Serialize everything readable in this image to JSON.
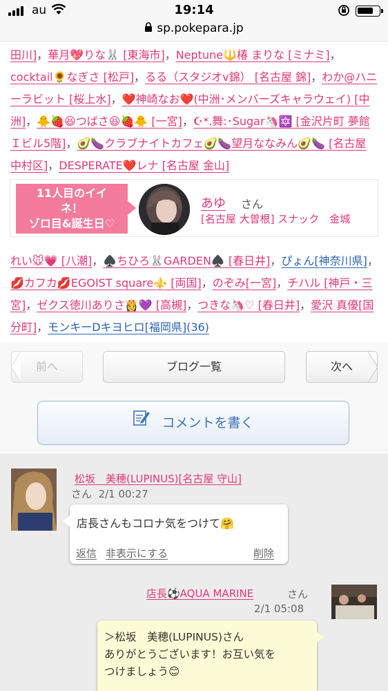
{
  "status_bar": {
    "carrier": "au",
    "time": "19:14",
    "battery_level": 0.75
  },
  "browser": {
    "url": "sp.pokepara.jp"
  },
  "link_list_top": [
    {
      "text": "田川]",
      "sep": "，"
    },
    {
      "text": "華月💖りな🐰 [東海市]",
      "sep": "，"
    },
    {
      "text": "Neptune🔱椿 まりな [ミナミ]",
      "sep": "，"
    },
    {
      "text": "cocktail🌻なぎさ [松戸]",
      "sep": "，"
    },
    {
      "text": "るる（スタジオv錦） [名古屋 錦]",
      "sep": "，"
    },
    {
      "text": "わか@ハニーラビット [桜上水]",
      "sep": "，"
    },
    {
      "text": "❤️神崎なお❤️(中洲･メンバーズキャラウェイ) [中洲]",
      "sep": "，"
    },
    {
      "text": "🐥🍓😆つばさ😆🍓🐥 [一宮]",
      "sep": "，"
    },
    {
      "text": "☪︎*.舞:･Sugar🦄🔯 [金沢片町 夢館Ｉビル5階]",
      "sep": "，"
    },
    {
      "text": "🥑🍆クラブナイトカフェ🥑🍆望月ななみん🥑🍆 [名古屋 中村区]",
      "sep": "，"
    },
    {
      "text": "DESPERATE❤️レナ [名古屋 金山]",
      "sep": ""
    }
  ],
  "iine_box": {
    "badge_line1": "11人目のイイ",
    "badge_line2": "ネ！",
    "badge_line3": "ゾロ目&誕生日♡",
    "name": "あゆ",
    "suffix": "さん",
    "shop": "[名古屋 大曽根] スナック　金城"
  },
  "link_list_bottom": [
    {
      "text": "れい🐭💗 [八潮]",
      "sep": "，",
      "color": "red"
    },
    {
      "text": "♠️ちひろ🐰GARDEN♠️ [春日井]",
      "sep": "，",
      "color": "red"
    },
    {
      "text": "ぴょん[神奈川県]",
      "sep": "，",
      "color": "blue"
    },
    {
      "text": "💋カフカ💋EGOIST square⚜️ [両国]",
      "sep": "，",
      "color": "red"
    },
    {
      "text": "のぞみ[一宮]",
      "sep": "，",
      "color": "red"
    },
    {
      "text": "チハル [神戸・三宮]",
      "sep": "，",
      "color": "red"
    },
    {
      "text": "ゼクス徳川ありさ👸💜 [高槻]",
      "sep": "，",
      "color": "red"
    },
    {
      "text": "つきな🦄♡ [春日井]",
      "sep": "，",
      "color": "red"
    },
    {
      "text": "愛沢 真優[国分町]",
      "sep": "，",
      "color": "red"
    },
    {
      "text": "モンキーDキヨヒロ[福岡県](36)",
      "sep": "",
      "color": "blue"
    }
  ],
  "nav": {
    "prev": "前へ",
    "list": "ブログ一覧",
    "next": "次へ",
    "comment": "コメントを書く"
  },
  "comments": [
    {
      "name": "松坂　美穂(LUPINUS)[名古屋 守山]",
      "suffix": "さん",
      "time": "2/1 00:27",
      "text": "店長さんもコロナ気をつけて🤗",
      "reply": "返信",
      "hide": "非表示にする",
      "delete": "削除"
    },
    {
      "name": "店長⚽AQUA MARINE",
      "suffix": "さん",
      "time": "2/1 05:08",
      "text": "＞松坂　美穂(LUPINUS)さん\nありがとうございます！お互い気を\nつけましょう😊"
    }
  ],
  "colors": {
    "link_red": "#e0387a",
    "link_blue": "#2a62b5",
    "badge_pink": "#f47b9c",
    "comment_blue": "#3d74b8",
    "reply_bubble": "#fdfbd5"
  }
}
